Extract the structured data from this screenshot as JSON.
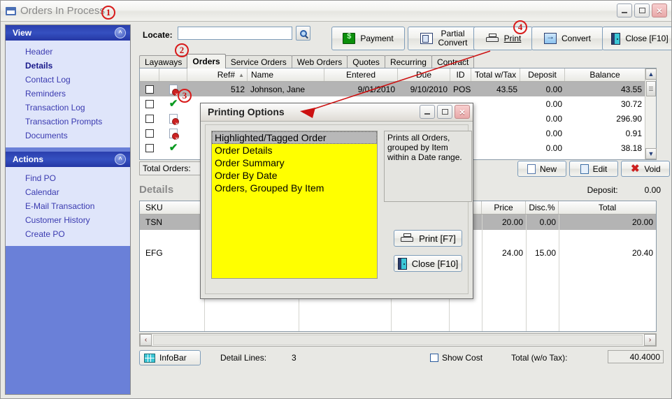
{
  "window": {
    "title": "Orders In Process",
    "minimize_label": "–",
    "maximize_label": "□",
    "close_label": "×"
  },
  "sidebar": {
    "panels": [
      {
        "title": "View",
        "collapse_icon": "chevron-up-icon",
        "items": [
          {
            "label": "Header",
            "active": false
          },
          {
            "label": "Details",
            "active": true
          },
          {
            "label": "Contact Log",
            "active": false
          },
          {
            "label": "Reminders",
            "active": false
          },
          {
            "label": "Transaction Log",
            "active": false
          },
          {
            "label": "Transaction Prompts",
            "active": false
          },
          {
            "label": "Documents",
            "active": false
          }
        ]
      },
      {
        "title": "Actions",
        "collapse_icon": "chevron-up-icon",
        "items": [
          {
            "label": "Find PO",
            "active": false
          },
          {
            "label": "Calendar",
            "active": false
          },
          {
            "label": "E-Mail Transaction",
            "active": false
          },
          {
            "label": "Customer History",
            "active": false
          },
          {
            "label": "Create PO",
            "active": false
          }
        ]
      }
    ]
  },
  "toolbar": {
    "locate_label": "Locate:",
    "locate_value": "",
    "locate_placeholder": "",
    "search_button_icon": "magnifier-icon",
    "buttons": [
      {
        "label": "Payment",
        "icon": "money-icon"
      },
      {
        "label": "Partial\nConvert",
        "icon": "partial-convert-icon"
      },
      {
        "label": "Print",
        "icon": "printer-icon"
      },
      {
        "label": "Convert",
        "icon": "convert-icon"
      },
      {
        "label": "Close [F10]",
        "icon": "door-exit-icon"
      }
    ]
  },
  "tabs": [
    {
      "label": "Layaways",
      "active": false
    },
    {
      "label": "Orders",
      "active": true
    },
    {
      "label": "Service Orders",
      "active": false
    },
    {
      "label": "Web Orders",
      "active": false
    },
    {
      "label": "Quotes",
      "active": false
    },
    {
      "label": "Recurring",
      "active": false
    },
    {
      "label": "Contract",
      "active": false
    }
  ],
  "order_grid": {
    "columns": [
      "",
      "",
      "Ref#",
      "Name",
      "Entered",
      "Due",
      "ID",
      "Total w/Tax",
      "Deposit",
      "Balance"
    ],
    "sort_column": "Ref#",
    "sort_indicator": "▲",
    "rows": [
      {
        "checked": false,
        "status_icon": "doc-error-icon",
        "ref": "512",
        "name": "Johnson, Jane",
        "entered": "9/01/2010",
        "due": "9/10/2010",
        "id": "POS",
        "total_w_tax": "43.55",
        "deposit": "0.00",
        "balance": "43.55",
        "selected": true
      },
      {
        "checked": false,
        "status_icon": "check-icon",
        "ref": "",
        "name": "",
        "entered": "",
        "due": "",
        "id": "",
        "total_w_tax": "",
        "deposit": "0.00",
        "balance": "30.72",
        "selected": false
      },
      {
        "checked": false,
        "status_icon": "doc-error-icon",
        "ref": "",
        "name": "",
        "entered": "",
        "due": "",
        "id": "",
        "total_w_tax": "",
        "deposit": "0.00",
        "balance": "296.90",
        "selected": false
      },
      {
        "checked": false,
        "status_icon": "doc-error-icon",
        "ref": "",
        "name": "",
        "entered": "",
        "due": "",
        "id": "",
        "total_w_tax": "",
        "deposit": "0.00",
        "balance": "0.91",
        "selected": false
      },
      {
        "checked": false,
        "status_icon": "check-icon",
        "ref": "",
        "name": "",
        "entered": "",
        "due": "",
        "id": "",
        "total_w_tax": "",
        "deposit": "0.00",
        "balance": "38.18",
        "selected": false
      }
    ],
    "total_orders_label": "Total Orders:",
    "total_orders_value": "",
    "scroll_up_icon": "▲",
    "scroll_down_icon": "▼"
  },
  "record_actions": [
    {
      "label": "New",
      "icon": "new-document-icon"
    },
    {
      "label": "Edit",
      "icon": "edit-document-icon"
    },
    {
      "label": "Void",
      "icon": "void-x-icon"
    }
  ],
  "details": {
    "title": "Details",
    "deposit_label": "Deposit:",
    "deposit_value": "0.00",
    "columns_left": [
      "SKU"
    ],
    "columns_right": [
      "Price",
      "Disc.%",
      "Total"
    ],
    "rows": [
      {
        "sku": "TSN",
        "price": "20.00",
        "disc": "0.00",
        "total": "20.00",
        "selected": true
      },
      {
        "sku": "EFG",
        "price": "24.00",
        "disc": "15.00",
        "total": "20.40",
        "selected": false
      }
    ]
  },
  "statusbar": {
    "infobar_label": "InfoBar",
    "infobar_icon": "grid-icon",
    "detail_lines_label": "Detail Lines:",
    "detail_lines_value": "3",
    "show_cost_label": "Show Cost",
    "show_cost_checked": false,
    "total_label": "Total (w/o Tax):",
    "total_value": "40.4000",
    "scroll_left_icon": "‹",
    "scroll_right_icon": "›"
  },
  "dialog": {
    "title": "Printing Options",
    "minimize_label": "–",
    "maximize_label": "□",
    "close_label": "×",
    "list_items": [
      {
        "label": "Highlighted/Tagged Order",
        "selected": true
      },
      {
        "label": "Order Details",
        "selected": false
      },
      {
        "label": "Order Summary",
        "selected": false
      },
      {
        "label": "Order By Date",
        "selected": false
      },
      {
        "label": "Orders, Grouped By Item",
        "selected": false
      }
    ],
    "description": "Prints all Orders, grouped by Item within a Date range.",
    "buttons": [
      {
        "label": "Print [F7]",
        "icon": "printer-icon"
      },
      {
        "label": "Close [F10]",
        "icon": "door-exit-icon"
      }
    ]
  },
  "annotations": [
    {
      "number": "1"
    },
    {
      "number": "2"
    },
    {
      "number": "3"
    },
    {
      "number": "4"
    }
  ],
  "colors": {
    "sidebar_blue": "#6a80d8",
    "panel_header_blue": "#2a3fae",
    "list_yellow": "#ffff00",
    "annotation_red": "#d81a1a",
    "selection_gray": "#b4b4b4"
  }
}
